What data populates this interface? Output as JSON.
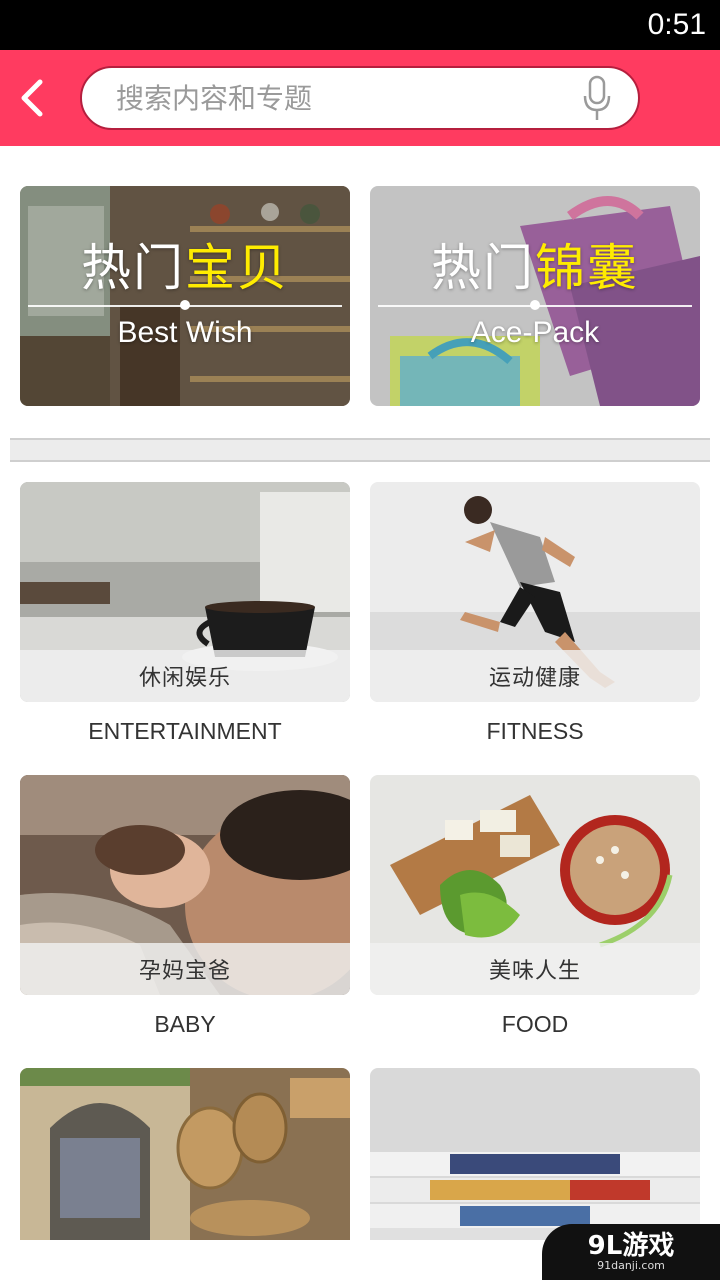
{
  "status": {
    "time": "0:51"
  },
  "search": {
    "placeholder": "搜索内容和专题"
  },
  "featured": [
    {
      "title_a": "热门",
      "title_b": "宝贝",
      "subtitle": "Best Wish"
    },
    {
      "title_a": "热门",
      "title_b": "锦囊",
      "subtitle": "Ace-Pack"
    }
  ],
  "categories": [
    {
      "cn": "休闲娱乐",
      "en": "ENTERTAINMENT"
    },
    {
      "cn": "运动健康",
      "en": "FITNESS"
    },
    {
      "cn": "孕妈宝爸",
      "en": "BABY"
    },
    {
      "cn": "美味人生",
      "en": "FOOD"
    }
  ],
  "watermark": {
    "main": "9L游戏",
    "sub": "91danji.com"
  },
  "colors": {
    "accent": "#ff3b60",
    "highlight": "#ffec00"
  }
}
